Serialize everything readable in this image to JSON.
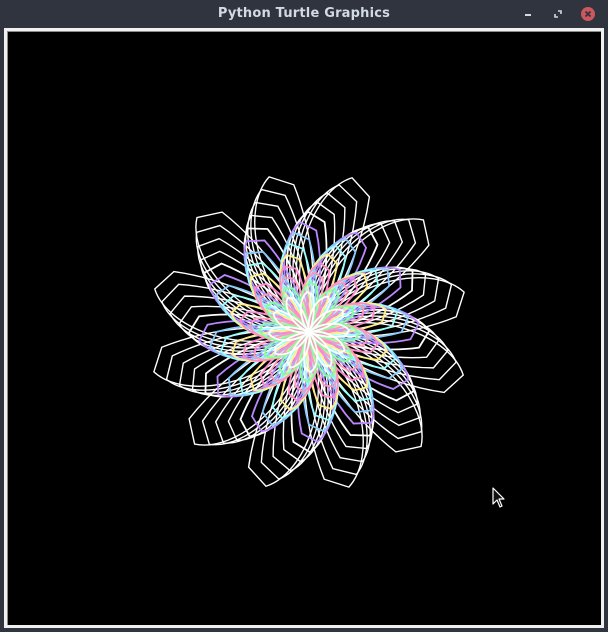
{
  "window": {
    "title": "Python Turtle Graphics",
    "controls": {
      "minimize_icon": "minimize-icon",
      "maximize_icon": "maximize-icon",
      "close_icon": "close-icon",
      "close_color": "#cc575d"
    },
    "titlebar_color": "#2f343f",
    "title_color": "#d3dae3"
  },
  "canvas": {
    "background": "#000000",
    "drawing": {
      "description_icon": "turtle-flower-spirograph",
      "petal_count": 12,
      "colors": [
        "#ffffff",
        "#ff88cc",
        "#88ccff",
        "#88ff99",
        "#ffee88",
        "#bb88ff",
        "#ff99bb",
        "#99ffff"
      ]
    },
    "cursor_icon": "mouse-pointer-icon"
  }
}
